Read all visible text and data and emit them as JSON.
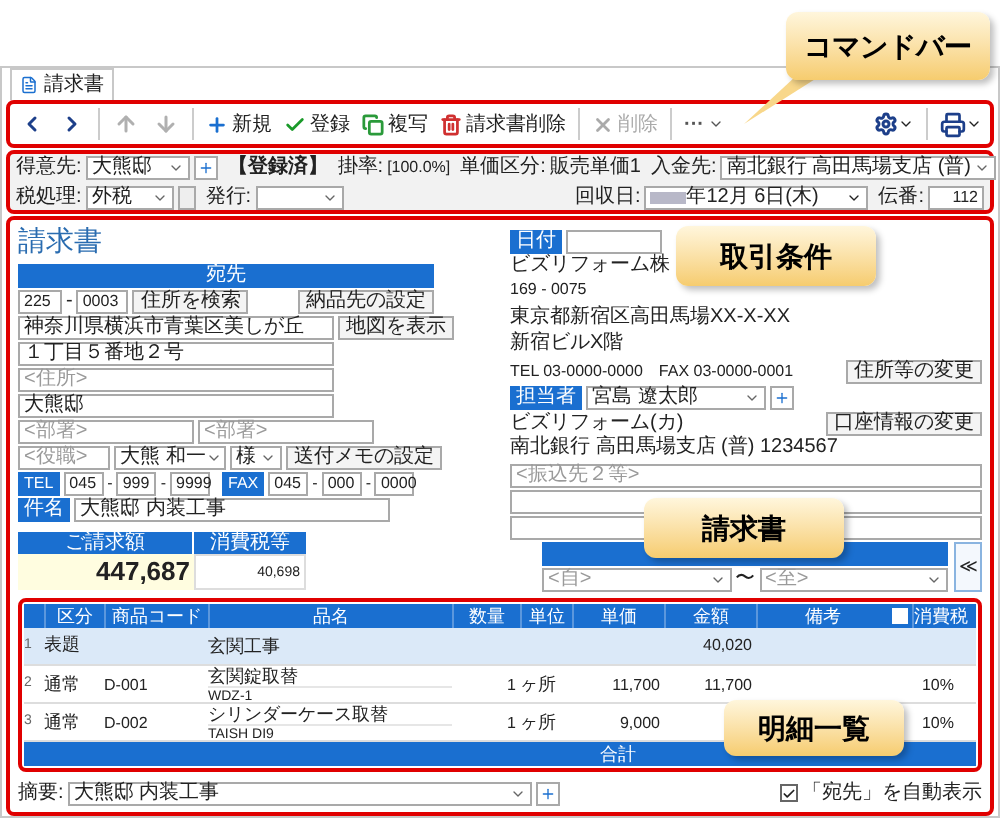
{
  "tab": {
    "label": "請求書",
    "selected": true
  },
  "nav_buttons": [
    {
      "kind": "prev",
      "disabled": false
    },
    {
      "kind": "next",
      "disabled": false
    },
    {
      "kind": "up",
      "disabled": true
    },
    {
      "kind": "down",
      "disabled": true
    }
  ],
  "actions": [
    {
      "kind": "new",
      "label": "新規",
      "disabled": false
    },
    {
      "kind": "save",
      "label": "登録",
      "disabled": false
    },
    {
      "kind": "copy",
      "label": "複写",
      "disabled": false
    },
    {
      "kind": "delete",
      "label": "請求書削除",
      "disabled": false
    },
    {
      "kind": "remove",
      "label": "削除",
      "disabled": true
    }
  ],
  "more_menu": {
    "label": "···"
  },
  "terms": {
    "customer": {
      "label": "得意先:",
      "value": "大熊邸"
    },
    "status": "【登録済】",
    "rate": {
      "label": "掛率:",
      "value": "[100.0%]"
    },
    "price_class": {
      "label": "単価区分:",
      "value": "販売単価1"
    },
    "deposit": {
      "label": "入金先:",
      "value": "南北銀行 高田馬場支店 (普)"
    },
    "tax": {
      "label": "税処理:",
      "value": "外税"
    },
    "issue": {
      "label": "発行:"
    },
    "collect_date": {
      "label": "回収日:",
      "value": "年12月 6日(木)"
    },
    "slip_no": {
      "label": "伝番:",
      "value": "112"
    }
  },
  "invoice": {
    "title": "請求書",
    "recipient": {
      "header": "宛先",
      "zip1": "225",
      "zip_sep": "-",
      "zip2": "0003",
      "search_button": "住所を検索",
      "delivery_button": "納品先の設定",
      "address1": "神奈川県横浜市青葉区美しが丘",
      "map_button": "地図を表示",
      "address2": "１丁目５番地２号",
      "address3_placeholder": "<住所>",
      "company": "大熊邸",
      "dept1_placeholder": "<部署>",
      "dept2_placeholder": "<部署>",
      "position_placeholder": "<役職>",
      "person": "大熊 和一",
      "honorific": "様",
      "memo_button": "送付メモの設定",
      "tel_label": "TEL",
      "tel": [
        "045",
        "999",
        "9999"
      ],
      "fax_label": "FAX",
      "fax": [
        "045",
        "000",
        "0000"
      ],
      "phone_sep": "-",
      "subject_label": "件名",
      "subject": "大熊邸 内装工事"
    },
    "amount": {
      "total_label": "ご請求額",
      "total": "447,687",
      "tax_label": "消費税等",
      "tax": "40,698"
    },
    "issuer": {
      "date_label": "日付",
      "company": "ビズリフォーム株",
      "zip": "169 - 0075",
      "address": "東京都新宿区高田馬場XX-X-XX",
      "building": "新宿ビルX階",
      "tel": "TEL 03-0000-0000",
      "fax": "FAX 03-0000-0001",
      "change_button": "住所等の変更",
      "staff_label": "担当者",
      "staff": "宮島 遼太郎",
      "account_name": "ビズリフォーム(カ)",
      "account_button": "口座情報の変更",
      "bank": "南北銀行 高田馬場支店 (普) 1234567",
      "transfer_placeholder": "<振込先２等>",
      "from_placeholder": "<自>",
      "range_sep": "〜",
      "to_placeholder": "<至>",
      "collapse": "≪"
    }
  },
  "table": {
    "columns": [
      "区分",
      "商品コード",
      "品名",
      "数量",
      "単位",
      "単価",
      "金額",
      "備考",
      "",
      "消費税"
    ],
    "rows": [
      {
        "no": "1",
        "category": "表題",
        "code": "",
        "name": "玄関工事",
        "spec": "",
        "qty": "",
        "unit": "",
        "price": "",
        "amount": "40,020",
        "tax": "",
        "selected": true
      },
      {
        "no": "2",
        "category": "通常",
        "code": "D-001",
        "name": "玄関錠取替",
        "spec": "WDZ-1",
        "qty": "1",
        "unit": "ヶ所",
        "price": "11,700",
        "amount": "11,700",
        "tax": "10%",
        "selected": false
      },
      {
        "no": "3",
        "category": "通常",
        "code": "D-002",
        "name": "シリンダーケース取替",
        "spec": "TAISH DI9",
        "qty": "1",
        "unit": "ヶ所",
        "price": "9,000",
        "amount": "",
        "tax": "10%",
        "selected": false
      }
    ],
    "total_label": "合計"
  },
  "footer": {
    "summary_label": "摘要:",
    "summary": "大熊邸 内装工事",
    "auto_show": {
      "label": "「宛先」を自動表示",
      "checked": true
    }
  },
  "callouts": [
    {
      "text": "コマンドバー"
    },
    {
      "text": "取引条件"
    },
    {
      "text": "請求書"
    },
    {
      "text": "明細一覧"
    }
  ]
}
